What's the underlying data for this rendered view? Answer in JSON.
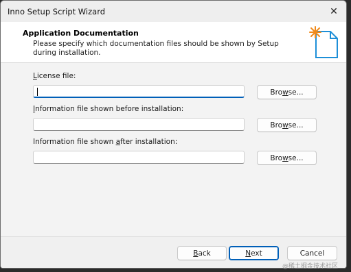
{
  "window": {
    "title": "Inno Setup Script Wizard"
  },
  "header": {
    "title": "Application Documentation",
    "description": "Please specify which documentation files should be shown by Setup during installation."
  },
  "fields": [
    {
      "label_underlined": "L",
      "label_rest": "icense file:",
      "value": ""
    },
    {
      "label_underlined": "I",
      "label_rest": "nformation file shown before installation:",
      "value": ""
    },
    {
      "label_pre": "Information file shown ",
      "label_underlined": "a",
      "label_rest": "fter installation:",
      "value": ""
    }
  ],
  "browse": {
    "pre": "Bro",
    "underlined": "w",
    "rest": "se..."
  },
  "footer": {
    "back": {
      "underlined": "B",
      "rest": "ack"
    },
    "next": {
      "underlined": "N",
      "rest": "ext"
    },
    "cancel": "Cancel"
  },
  "watermark": "@稀土掘金技术社区",
  "colors": {
    "accent": "#005fb8",
    "window_bg": "#f3f3f3",
    "header_bg": "#ffffff"
  },
  "icons": {
    "close": "close-icon",
    "wizard": "wizard-document-icon"
  }
}
